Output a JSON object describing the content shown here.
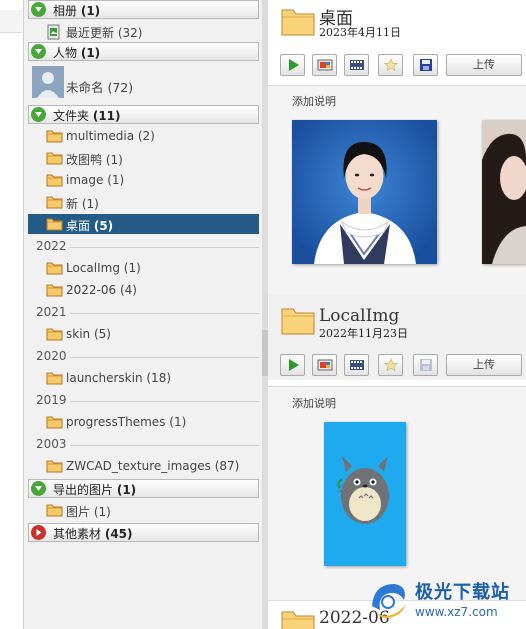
{
  "sidebar": {
    "albums_header": {
      "name": "相册",
      "count": "(1)"
    },
    "albums": [
      {
        "label": "最近更新 (32)"
      }
    ],
    "people_header": {
      "name": "人物",
      "count": "(1)"
    },
    "people": [
      {
        "label": "未命名 (72)"
      }
    ],
    "folders_header": {
      "name": "文件夹",
      "count": "(11)"
    },
    "folders_top": [
      {
        "label": "multimedia (2)"
      },
      {
        "label": "改图鸭 (1)"
      },
      {
        "label": "image (1)"
      },
      {
        "label": "新 (1)"
      }
    ],
    "selected_folder": {
      "name": "桌面",
      "count": "(5)"
    },
    "years": [
      {
        "year": "2022",
        "items": [
          {
            "label": "LocalImg (1)"
          },
          {
            "label": "2022-06 (4)"
          }
        ]
      },
      {
        "year": "2021",
        "items": [
          {
            "label": "skin (5)"
          }
        ]
      },
      {
        "year": "2020",
        "items": [
          {
            "label": "launcherskin (18)"
          }
        ]
      },
      {
        "year": "2019",
        "items": [
          {
            "label": "progressThemes (1)"
          }
        ]
      },
      {
        "year": "2003",
        "items": [
          {
            "label": "ZWCAD_texture_images (87)"
          }
        ]
      }
    ],
    "exported_header": {
      "name": "导出的图片",
      "count": "(1)"
    },
    "exported": [
      {
        "label": "图片 (1)"
      }
    ],
    "other_header": {
      "name": "其他素材",
      "count": "(45)"
    }
  },
  "albums": [
    {
      "name": "桌面",
      "date": "2023年4月11日",
      "upload_label": "上传",
      "caption_placeholder": "添加说明"
    },
    {
      "name": "LocalImg",
      "date": "2022年11月23日",
      "upload_label": "上传",
      "caption_placeholder": "添加说明"
    },
    {
      "name": "2022-06"
    }
  ],
  "toolbar_icons": [
    "play-icon",
    "photo-collage-icon",
    "movie-icon",
    "star-icon",
    "save-icon"
  ],
  "watermark": {
    "title": "极光下载站",
    "url": "www.xz7.com"
  },
  "colors": {
    "selected_row": "#245b86",
    "expand_green": "#4aa63a",
    "collapse_red": "#c8322d",
    "folder": "#f2b54a",
    "photo_blue_bg": "#1f5fb0",
    "totoro_bg": "#1fa9ee"
  }
}
